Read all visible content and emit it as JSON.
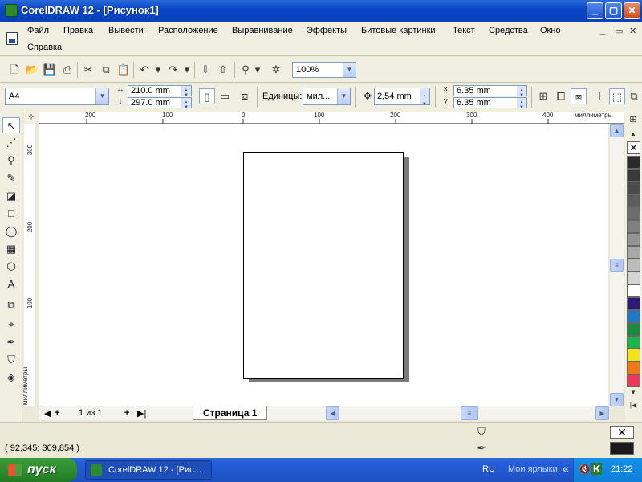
{
  "window": {
    "title": "CorelDRAW 12 - [Рисунок1]",
    "min": "_",
    "max": "▢",
    "close": "✕"
  },
  "menu": {
    "items": [
      "Файл",
      "Правка",
      "Вывести",
      "Расположение",
      "Выравнивание",
      "Эффекты",
      "Битовые картинки",
      "Текст",
      "Средства",
      "Окно",
      "Справка"
    ],
    "mdi": [
      "_",
      "▭",
      "✕"
    ]
  },
  "standard_toolbar": {
    "zoom": "100%"
  },
  "property_bar": {
    "paper_size": "A4",
    "width": "210.0 mm",
    "height": "297.0 mm",
    "units_label": "Единицы:",
    "units_value": "мил...",
    "nudge": "2,54 mm",
    "dup_x": "6.35 mm",
    "dup_y": "6.35 mm",
    "x_label": "x",
    "y_label": "y"
  },
  "ruler": {
    "h_labels": [
      "200",
      "100",
      "0",
      "100",
      "200",
      "300",
      "400"
    ],
    "h_units": "миллиметры",
    "v_labels": [
      "300",
      "200",
      "100"
    ],
    "v_units": "миллиметры"
  },
  "page_nav": {
    "count": "1 из 1",
    "tab": "Страница 1"
  },
  "status": {
    "coords": "( 92,345; 309,854 )"
  },
  "taskbar": {
    "start": "пуск",
    "task": "CorelDRAW 12 - [Рис...",
    "lang": "RU",
    "shortcuts": "Мои ярлыки",
    "clock": "21:22"
  },
  "palette": {
    "colors": [
      "#2b2b2b",
      "#3a3a3a",
      "#4b4b4b",
      "#5c5c5c",
      "#6d6d6d",
      "#808080",
      "#949494",
      "#a8a8a8",
      "#bcbcbc",
      "#d4d4d4",
      "#ffffff",
      "#2e1a78",
      "#1f78c8",
      "#1c8c3c",
      "#1fb34a",
      "#f1e51a",
      "#f07818",
      "#e83a5a"
    ]
  }
}
